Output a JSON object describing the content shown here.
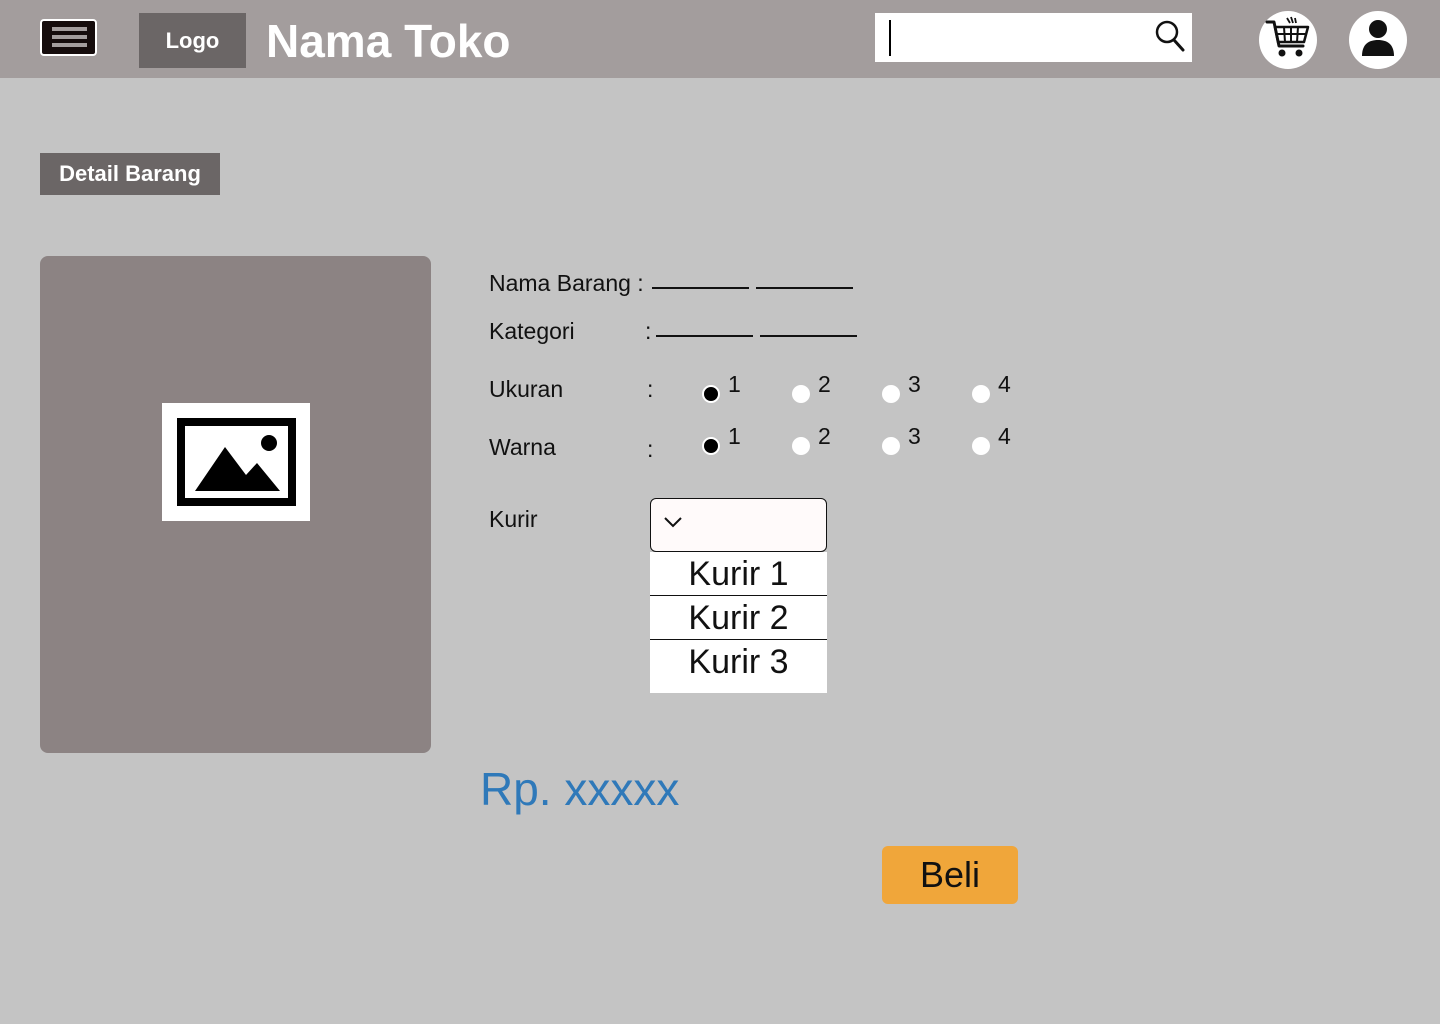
{
  "header": {
    "logo_label": "Logo",
    "store_name": "Nama Toko",
    "search": {
      "value": "",
      "placeholder": ""
    },
    "icons": {
      "menu": "hamburger-icon",
      "search": "search-icon",
      "cart": "cart-icon",
      "profile": "user-icon"
    }
  },
  "section_title": "Detail Barang",
  "product": {
    "image_icon": "image-placeholder-icon",
    "fields": {
      "nama_label": "Nama Barang :",
      "kategori_label": "Kategori",
      "ukuran_label": "Ukuran",
      "warna_label": "Warna",
      "kurir_label": "Kurir",
      "colon": ":"
    },
    "ukuran_options": [
      "1",
      "2",
      "3",
      "4"
    ],
    "ukuran_selected": "1",
    "warna_options": [
      "1",
      "2",
      "3",
      "4"
    ],
    "warna_selected": "1",
    "kurir_selected": "",
    "kurir_options": [
      "Kurir 1",
      "Kurir 2",
      "Kurir 3"
    ],
    "price": "Rp. xxxxx",
    "buy_label": "Beli"
  },
  "colors": {
    "header_bg": "#a39d9d",
    "page_bg": "#c4c4c4",
    "dark_box": "#6b6666",
    "image_panel": "#8c8383",
    "price": "#2f79b9",
    "buy_button": "#f0a63a"
  }
}
